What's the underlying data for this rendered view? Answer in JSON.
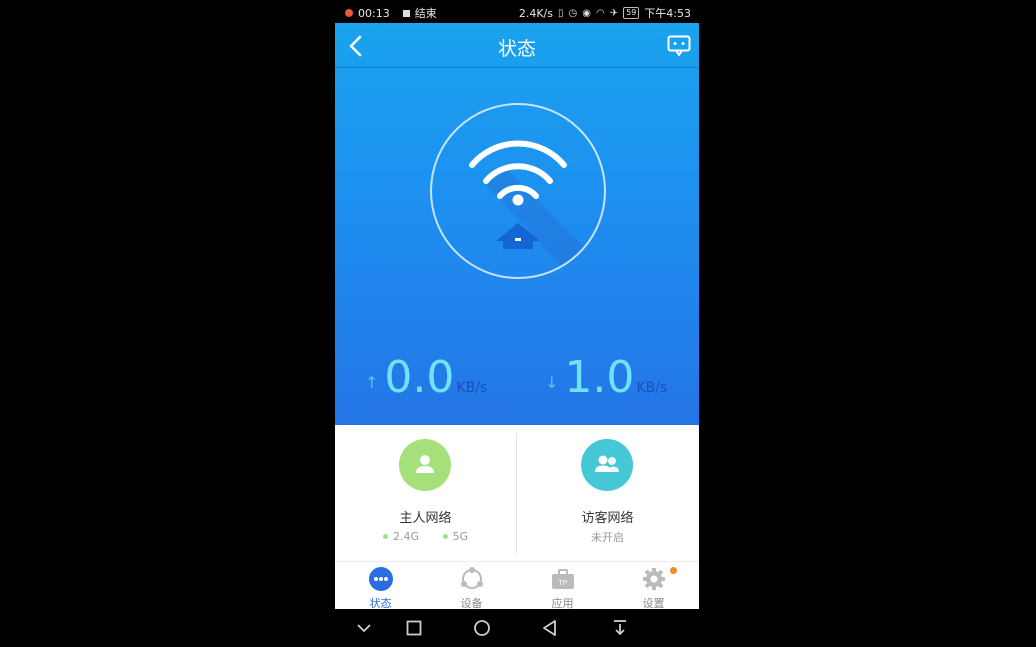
{
  "status_bar": {
    "rec_time": "00:13",
    "rec_stop_label": "结束",
    "net_speed": "2.4K/s",
    "battery": "59",
    "clock": "下午4:53"
  },
  "header": {
    "title": "状态"
  },
  "traffic": {
    "upload_value": "0.0",
    "upload_unit": "KB/s",
    "download_value": "1.0",
    "download_unit": "KB/s"
  },
  "networks": {
    "host": {
      "name": "主人网络",
      "band1": "2.4G",
      "band2": "5G"
    },
    "guest": {
      "name": "访客网络",
      "status": "未开启"
    }
  },
  "tabs": [
    {
      "label": "状态",
      "icon": "status-dots-icon",
      "active": true
    },
    {
      "label": "设备",
      "icon": "devices-icon"
    },
    {
      "label": "应用",
      "icon": "toolbox-icon"
    },
    {
      "label": "设置",
      "icon": "gear-icon"
    }
  ],
  "colors": {
    "accent": "#2a6de0",
    "hero_top": "#1aa3ee",
    "hero_bottom": "#2475e6",
    "speed_value": "#6fe3f5",
    "host_icon_bg": "#a6e07a",
    "guest_icon_bg": "#45c7d6",
    "badge": "#f08c2c"
  }
}
